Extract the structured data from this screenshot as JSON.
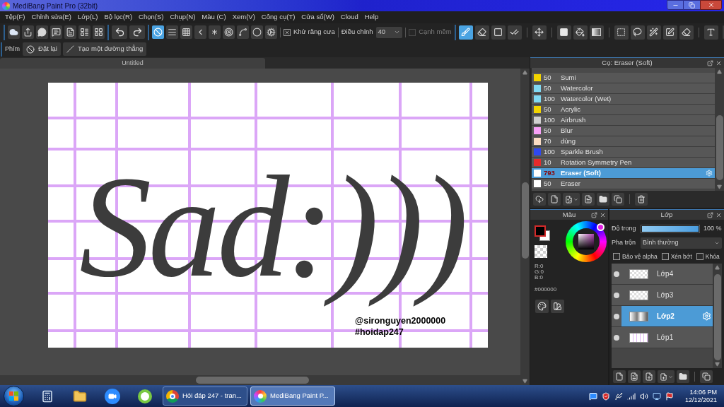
{
  "window": {
    "title": "MediBang Paint Pro (32bit)"
  },
  "menu": [
    "Tệp(F)",
    "Chỉnh sửa(E)",
    "Lớp(L)",
    "Bộ lọc(R)",
    "Chọn(S)",
    "Chụp(N)",
    "Màu (C)",
    "Xem(V)",
    "Công cụ(T)",
    "Cửa sổ(W)",
    "Cloud",
    "Help"
  ],
  "ruler_modes": [
    {
      "selected": true
    },
    {
      "selected": false
    },
    {
      "selected": false
    },
    {
      "selected": false
    },
    {
      "selected": false
    },
    {
      "selected": false
    },
    {
      "selected": false
    },
    {
      "selected": false
    },
    {
      "selected": false
    }
  ],
  "ruler_options": {
    "antialias": {
      "label": "Khử răng cưa",
      "checked": true
    },
    "correction": {
      "label": "Điều chỉnh",
      "value": "40"
    },
    "soft_edge": {
      "label": "Cạnh mềm",
      "checked": false,
      "disabled": true
    }
  },
  "tools": [
    {
      "selected": true
    },
    {
      "selected": false
    },
    {
      "selected": false
    },
    {
      "selected": false
    },
    {
      "selected": false
    },
    {
      "selected": false
    },
    {
      "selected": false
    },
    {
      "selected": false
    },
    {
      "selected": false
    },
    {
      "selected": false
    },
    {
      "selected": false
    },
    {
      "selected": false
    },
    {
      "selected": false
    },
    {
      "selected": false
    }
  ],
  "shortcut_bar": {
    "label": "Phím",
    "buttons": [
      "Đặt lại",
      "Tạo một đường thẳng"
    ]
  },
  "document_tab": {
    "title": "Untitled"
  },
  "canvas": {
    "lettering": "Sad:)))",
    "credits": [
      "@sironguyen2000000",
      "#hoidap247"
    ]
  },
  "brush_panel": {
    "title": "Cọ: Eraser (Soft)",
    "brushes": [
      {
        "size": "50",
        "name": "Sumi",
        "color": "#f2d400",
        "selected": false
      },
      {
        "size": "50",
        "name": "Watercolor",
        "color": "#80d8f2",
        "selected": false
      },
      {
        "size": "100",
        "name": "Watercolor (Wet)",
        "color": "#80d8f2",
        "selected": false
      },
      {
        "size": "50",
        "name": "Acrylic",
        "color": "#f2d400",
        "selected": false
      },
      {
        "size": "100",
        "name": "Airbrush",
        "color": "#d0d0d0",
        "selected": false
      },
      {
        "size": "50",
        "name": "Blur",
        "color": "#f7a0f7",
        "selected": false
      },
      {
        "size": "70",
        "name": "dùng",
        "color": "#fadcc4",
        "selected": false
      },
      {
        "size": "100",
        "name": "Sparkle Brush",
        "color": "#2f48f0",
        "selected": false
      },
      {
        "size": "10",
        "name": "Rotation Symmetry Pen",
        "color": "#e62b2b",
        "selected": false
      },
      {
        "size": "793",
        "name": "Eraser (Soft)",
        "color": "#ffffff",
        "selected": true
      },
      {
        "size": "50",
        "name": "Eraser",
        "color": "#ffffff",
        "selected": false
      }
    ]
  },
  "color_panel": {
    "title": "Màu",
    "channels": [
      "R:0",
      "G:0",
      "B:0"
    ],
    "hex": "#000000"
  },
  "layer_panel": {
    "title": "Lớp",
    "opacity": {
      "label": "Độ trong",
      "level": 1,
      "reading": "100 %"
    },
    "blend": {
      "label": "Pha trộn",
      "value": "Bình thường"
    },
    "options": [
      {
        "label": "Bảo vệ alpha",
        "checked": false
      },
      {
        "label": "Xén bớt",
        "checked": false
      },
      {
        "label": "Khóa",
        "checked": false
      }
    ],
    "layers": [
      {
        "name": "Lớp4",
        "visible": true,
        "selected": false
      },
      {
        "name": "Lớp3",
        "visible": true,
        "selected": false
      },
      {
        "name": "Lớp2",
        "visible": true,
        "selected": true
      },
      {
        "name": "Lớp1",
        "visible": true,
        "selected": false
      }
    ]
  },
  "taskbar": {
    "windows": [
      {
        "title": "Hỏi đáp 247 - tran...",
        "selected": false
      },
      {
        "title": "MediBang Paint P...",
        "selected": true
      }
    ],
    "clock": {
      "time": "14:06 PM",
      "date": "12/12/2021"
    }
  }
}
